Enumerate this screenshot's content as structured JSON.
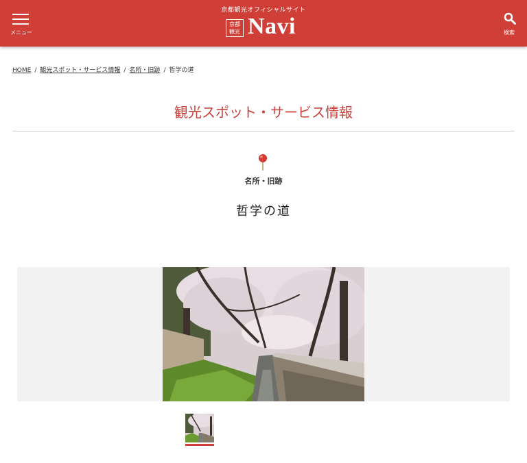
{
  "header": {
    "menu_label": "メニュー",
    "logo_tagline": "京都観光オフィシャルサイト",
    "logo_box_line1": "京都",
    "logo_box_line2": "観光",
    "logo_word": "Navi",
    "search_label": "検索",
    "brand_color": "#cf3f37"
  },
  "breadcrumb": {
    "items": [
      "HOME",
      "観光スポット・サービス情報",
      "名所・旧跡"
    ],
    "current": "哲学の道",
    "separator": "/"
  },
  "section_title": "観光スポット・サービス情報",
  "category": {
    "icon": "map-pin-icon",
    "label": "名所・旧跡"
  },
  "spot_title": "哲学の道",
  "gallery": {
    "main_image": "cherry-blossom-canal-photo",
    "thumbnails": [
      "cherry-blossom-canal-thumb"
    ],
    "selected_index": 0
  }
}
